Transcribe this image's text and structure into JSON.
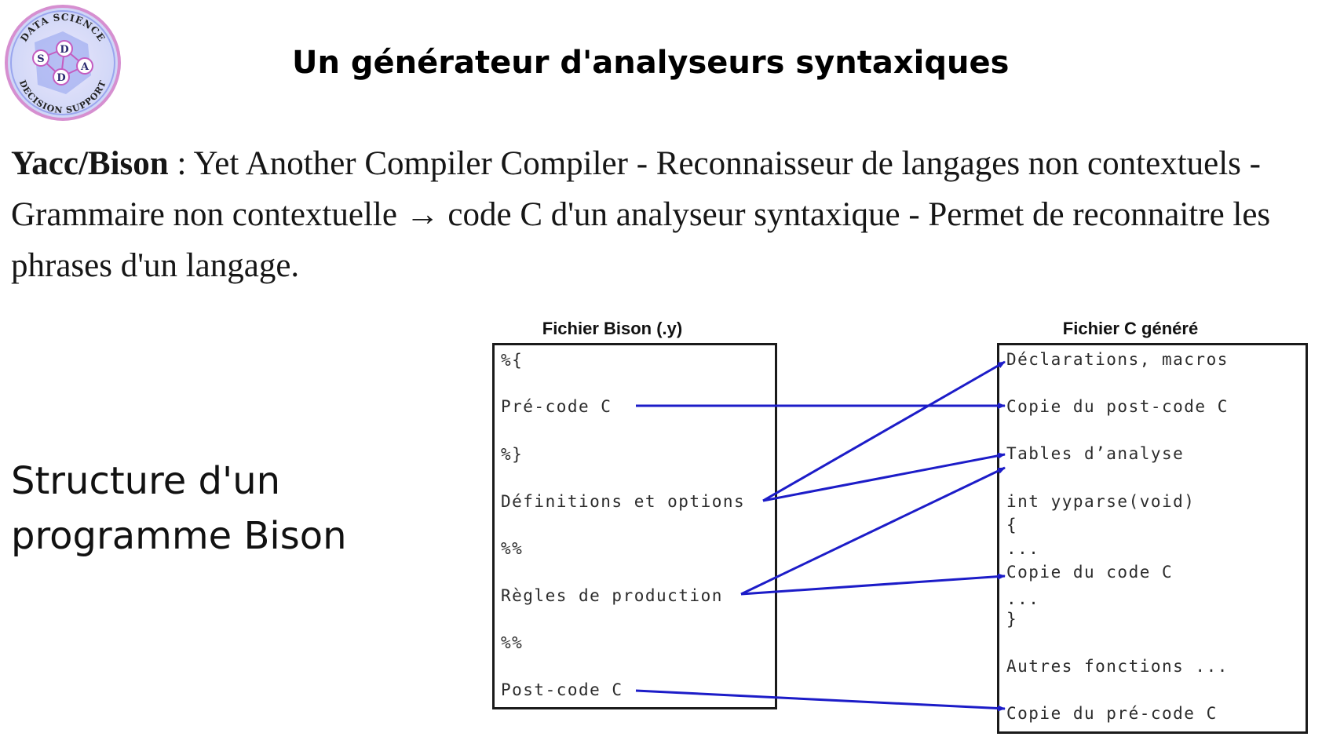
{
  "logo": {
    "text_top": "DATA SCIENCE",
    "text_bottom": "DECISION SUPPORT",
    "letters": [
      "S",
      "D",
      "D",
      "A"
    ]
  },
  "title": "Un générateur d'analyseurs syntaxiques",
  "intro": {
    "lead": "Yacc/Bison",
    "text": " : Yet Another Compiler Compiler - Reconnaisseur de langages non contextuels - Grammaire non contextuelle → code C d'un analyseur syntaxique - Permet de reconnaitre les phrases d'un langage."
  },
  "structure_heading": "Structure d'un programme Bison",
  "diagram": {
    "bison_caption": "Fichier Bison (.y)",
    "generated_caption": "Fichier C généré",
    "bison_lines": {
      "open_brace": "%{",
      "precode": "Pré-code C",
      "close_brace": "%}",
      "definitions": "Définitions et options",
      "sep1": "%%",
      "rules": "Règles de production",
      "sep2": "%%",
      "postcode": "Post-code C"
    },
    "generated_lines": {
      "declarations": "Déclarations, macros",
      "copy_postcode": "Copie du post-code C",
      "tables": "Tables d’analyse",
      "yyparse": "int yyparse(void)",
      "brace_open": "{",
      "dots1": "...",
      "copy_code": "Copie du code C",
      "dots2": "...",
      "brace_close": "}",
      "others": "Autres fonctions ...",
      "copy_precode": "Copie du pré-code C"
    },
    "arrow_color": "#1c1cc8"
  }
}
